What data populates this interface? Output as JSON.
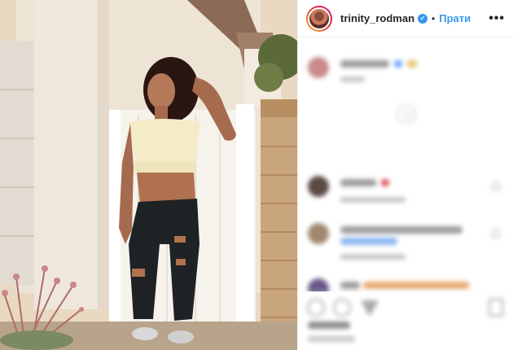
{
  "post": {
    "username": "trinity_rodman",
    "verified_symbol": "✓",
    "separator": "•",
    "follow_label": "Прати",
    "more_symbol": "•••"
  },
  "icons": {
    "header_more": "more-options-icon",
    "verified": "verified-badge-icon",
    "like": "heart-outline-icon",
    "comment": "comment-bubble-icon",
    "share": "paper-plane-icon",
    "save": "bookmark-icon",
    "load_more": "plus-circle-icon"
  },
  "colors": {
    "accent": "#3897f0",
    "text": "#262626",
    "muted": "#8e8e8e",
    "border": "#efefef"
  }
}
